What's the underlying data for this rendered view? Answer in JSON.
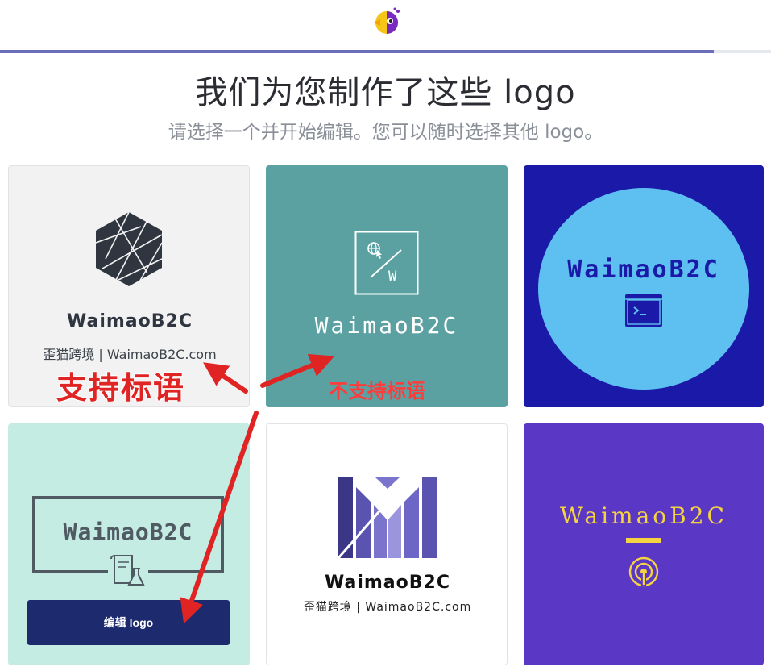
{
  "header": {
    "progress": 0.926,
    "colors": {
      "progress": "#6a6fb8",
      "track": "#e6e8ef"
    }
  },
  "page": {
    "title": "我们为您制作了这些 logo",
    "subtitle": "请选择一个并开始编辑。您可以随时选择其他 logo。"
  },
  "cards": [
    {
      "name": "WaimaoB2C",
      "tagline": "歪猫跨境 | WaimaoB2C.com",
      "icon": "geometric-hexagon-icon",
      "bg": "#f2f2f3"
    },
    {
      "name": "WaimaoB2C",
      "icon": "globe-cursor-frame-icon",
      "icon_letter": "W",
      "bg": "#5ba1a1"
    },
    {
      "name": "WaimaoB2C",
      "icon": "terminal-window-icon",
      "bg": "#1b1aa8"
    },
    {
      "name": "WaimaoB2C",
      "icon": "lab-document-icon",
      "bg": "#c4ece2",
      "hover_button": "编辑 logo"
    },
    {
      "name": "WaimaoB2C",
      "tagline": "歪猫跨境 | WaimaoB2C.com",
      "icon": "stripes-m-icon",
      "bg": "#ffffff"
    },
    {
      "name": "WaimaoB2C",
      "icon": "broadcast-signal-icon",
      "bg": "#5a37c4"
    }
  ],
  "annotations": {
    "supports_slogan": "支持标语",
    "no_slogan": "不支持标语",
    "color": "#e02424"
  }
}
